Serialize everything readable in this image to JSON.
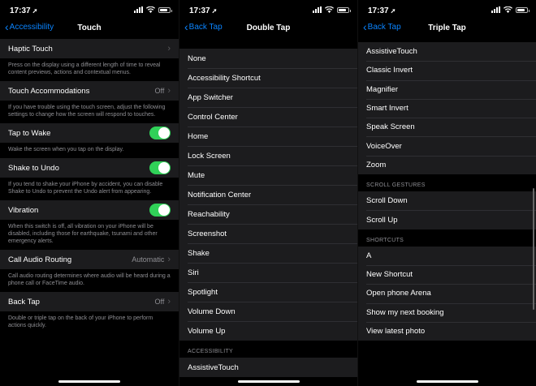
{
  "status": {
    "time": "17:37"
  },
  "screen1": {
    "title": "Touch",
    "back": "Accessibility",
    "rows": {
      "haptic": {
        "label": "Haptic Touch",
        "footer": "Press on the display using a different length of time to reveal content previews, actions and contextual menus."
      },
      "accom": {
        "label": "Touch Accommodations",
        "value": "Off",
        "footer": "If you have trouble using the touch screen, adjust the following settings to change how the screen will respond to touches."
      },
      "wake": {
        "label": "Tap to Wake",
        "footer": "Wake the screen when you tap on the display."
      },
      "shake": {
        "label": "Shake to Undo",
        "footer": "If you tend to shake your iPhone by accident, you can disable Shake to Undo to prevent the Undo alert from appearing."
      },
      "vibration": {
        "label": "Vibration",
        "footer": "When this switch is off, all vibration on your iPhone will be disabled, including those for earthquake, tsunami and other emergency alerts."
      },
      "audio": {
        "label": "Call Audio Routing",
        "value": "Automatic",
        "footer": "Call audio routing determines where audio will be heard during a phone call or FaceTime audio."
      },
      "backtap": {
        "label": "Back Tap",
        "value": "Off",
        "footer": "Double or triple tap on the back of your iPhone to perform actions quickly."
      }
    }
  },
  "screen2": {
    "title": "Double Tap",
    "back": "Back Tap",
    "items": [
      "None",
      "Accessibility Shortcut",
      "App Switcher",
      "Control Center",
      "Home",
      "Lock Screen",
      "Mute",
      "Notification Center",
      "Reachability",
      "Screenshot",
      "Shake",
      "Siri",
      "Spotlight",
      "Volume Down",
      "Volume Up"
    ],
    "accessibility_header": "ACCESSIBILITY",
    "accessibility_items": [
      "AssistiveTouch"
    ]
  },
  "screen3": {
    "title": "Triple Tap",
    "back": "Back Tap",
    "items": [
      "AssistiveTouch",
      "Classic Invert",
      "Magnifier",
      "Smart Invert",
      "Speak Screen",
      "VoiceOver",
      "Zoom"
    ],
    "scroll_header": "SCROLL GESTURES",
    "scroll_items": [
      "Scroll Down",
      "Scroll Up"
    ],
    "shortcuts_header": "SHORTCUTS",
    "shortcut_items": [
      "A",
      "New Shortcut",
      "Open phone Arena",
      "Show my next booking",
      "View latest photo"
    ]
  },
  "colors": {
    "accent": "#0a84ff",
    "toggle_on": "#30d158",
    "cell": "#1c1c1e"
  }
}
